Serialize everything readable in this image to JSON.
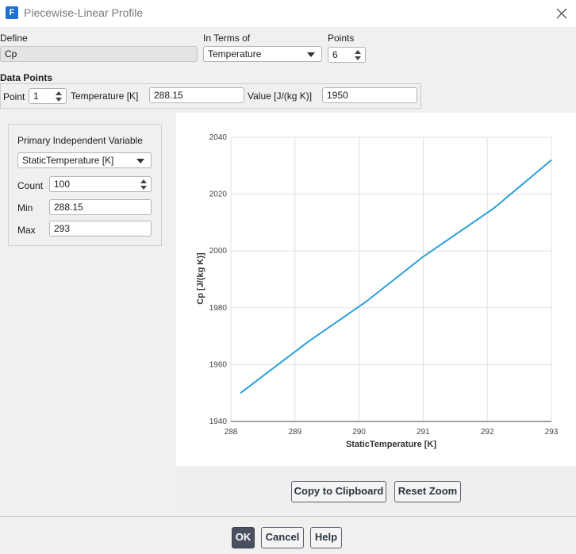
{
  "window": {
    "title": "Piecewise-Linear Profile"
  },
  "define": {
    "label": "Define",
    "value": "Cp"
  },
  "in_terms_of": {
    "label": "In Terms of",
    "value": "Temperature"
  },
  "points": {
    "label": "Points",
    "value": "6"
  },
  "data_points": {
    "label": "Data Points",
    "point_label": "Point",
    "point_value": "1",
    "temperature_label": "Temperature [K]",
    "temperature_value": "288.15",
    "value_label": "Value [J/(kg K)]",
    "value_value": "1950"
  },
  "plot_settings": {
    "primary_label": "Primary Independent Variable",
    "primary_value": "StaticTemperature [K]",
    "count_label": "Count",
    "count_value": "100",
    "min_label": "Min",
    "min_value": "288.15",
    "max_label": "Max",
    "max_value": "293"
  },
  "buttons": {
    "copy": "Copy to Clipboard",
    "reset": "Reset Zoom",
    "ok": "OK",
    "cancel": "Cancel",
    "help": "Help"
  },
  "colors": {
    "line": "#2b9fd9",
    "grid": "#e0e0e0",
    "accent": "#1f6fd8"
  },
  "chart_data": {
    "type": "line",
    "xlabel": "StaticTemperature [K]",
    "ylabel": "Cp [J/(kg K)]",
    "xlim": [
      288,
      293
    ],
    "ylim": [
      1940,
      2040
    ],
    "xticks": [
      "288",
      "289",
      "290",
      "291",
      "292",
      "293"
    ],
    "yticks": [
      "1940",
      "1960",
      "1980",
      "2000",
      "2020",
      "2040"
    ],
    "grid": true,
    "series": [
      {
        "x": [
          288.15,
          289.2,
          290.1,
          291.0,
          292.1,
          293.0
        ],
        "y": [
          1950,
          1968,
          1982,
          1998,
          2015,
          2032
        ]
      }
    ]
  }
}
